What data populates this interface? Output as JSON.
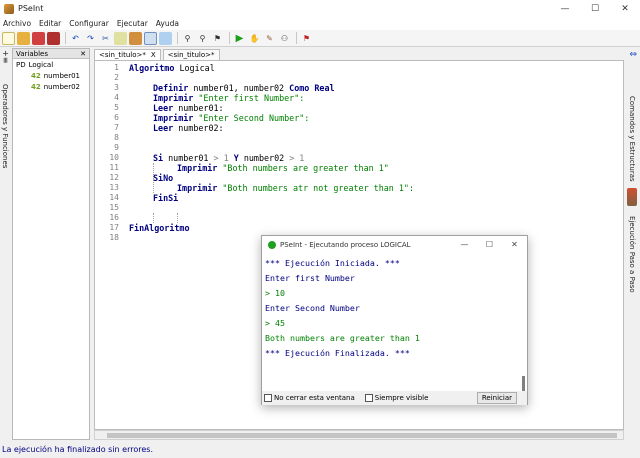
{
  "window": {
    "title": "PSeInt",
    "min": "—",
    "max": "☐",
    "close": "✕"
  },
  "menu": [
    "Archivo",
    "Editar",
    "Configurar",
    "Ejecutar",
    "Ayuda"
  ],
  "left": {
    "vertical_label": "Operadores y Funciones"
  },
  "variables": {
    "header": "Variables",
    "close": "✕",
    "algorithm_icon": "PD",
    "algorithm": "Logical",
    "items": [
      {
        "icon": "42",
        "name": "number01"
      },
      {
        "icon": "42",
        "name": "number02"
      }
    ]
  },
  "tabs": [
    {
      "label": "<sin_titulo>*",
      "close": "X"
    },
    {
      "label": "<sin_titulo>*"
    }
  ],
  "code": {
    "line_numbers": [
      "1",
      "2",
      "3",
      "4",
      "5",
      "6",
      "7",
      "8",
      "9",
      "10",
      "11",
      "12",
      "13",
      "14",
      "15",
      "16",
      "17",
      "18"
    ],
    "l1_kw": "Algoritmo",
    "l1_name": "Logical",
    "l3_kw1": "Definir",
    "l3_vars": "number01, number02",
    "l3_kw2": "Como",
    "l3_kw3": "Real",
    "l4_kw": "Imprimir",
    "l4_str": "\"Enter first Number\":",
    "l5_kw": "Leer",
    "l5_var": "number01:",
    "l6_kw": "Imprimir",
    "l6_str": "\"Enter Second Number\":",
    "l7_kw": "Leer",
    "l7_var": "number02:",
    "l10_kw1": "Si",
    "l10_a": "number01",
    "l10_op1": ">",
    "l10_n1": "1",
    "l10_kw2": "Y",
    "l10_b": "number02",
    "l10_op2": ">",
    "l10_n2": "1",
    "l11_kw": "Imprimir",
    "l11_str": "\"Both numbers are greater than 1\"",
    "l12_kw": "SiNo",
    "l13_kw": "Imprimir",
    "l13_str": "\"Both numbers atr not greater than 1\":",
    "l14_kw": "FinSi",
    "l17_kw": "FinAlgoritmo"
  },
  "right": {
    "label1": "Comandos y Estructuras",
    "label2": "Ejecución Paso a Paso"
  },
  "status": "La ejecución ha finalizado sin errores.",
  "popup": {
    "title": "PSeInt - Ejecutando proceso LOGICAL",
    "min": "—",
    "max": "☐",
    "close": "✕",
    "lines": [
      "*** Ejecución Iniciada. ***",
      "Enter first Number",
      "> 10",
      "Enter Second Number",
      "> 45",
      "Both numbers are greater than 1",
      "*** Ejecución Finalizada. ***"
    ],
    "keep_open": "No cerrar esta ventana",
    "always_visible": "Siempre visible",
    "restart": "Reiniciar"
  },
  "colors": {
    "keyword": "#000080",
    "string": "#008000",
    "number": "#808080",
    "status": "#000080"
  }
}
